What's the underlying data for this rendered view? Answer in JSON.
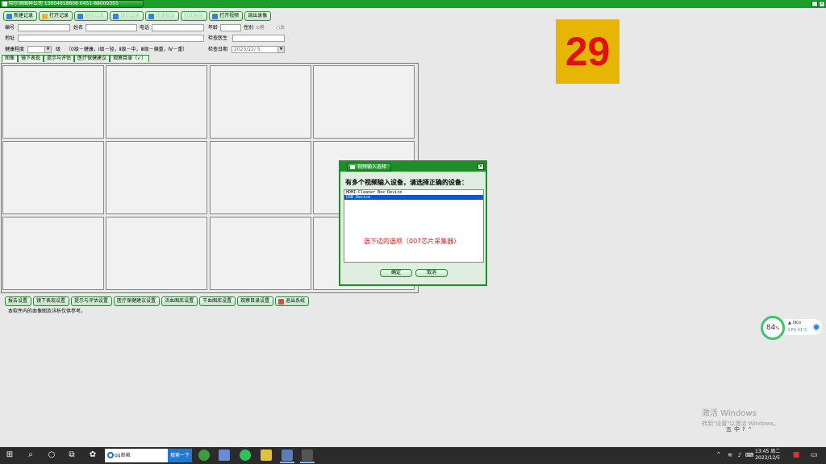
{
  "window": {
    "title": "哈尔滨国祥公司  13904618606    0451-88009355"
  },
  "toolbar": [
    {
      "label": "新建记录",
      "enabled": true
    },
    {
      "label": "打开记录",
      "enabled": true
    },
    {
      "label": "删除记录",
      "enabled": false
    },
    {
      "label": "保存记录",
      "enabled": false
    },
    {
      "label": "快速报告",
      "enabled": false
    },
    {
      "label": "打印报告",
      "enabled": false
    },
    {
      "label": "打开视频",
      "enabled": true
    },
    {
      "label": "调出录像",
      "enabled": true
    }
  ],
  "form": {
    "id_label": "编号",
    "name_label": "姓名",
    "phone_label": "电话",
    "age_label": "年龄",
    "gender_label": "性别",
    "gender_male": "男",
    "gender_female": "女",
    "address_label": "地址",
    "doctor_label": "检查医生",
    "health_label": "健康程度",
    "level_unit": "级",
    "level_hint": "（0级－健康，Ⅰ级－轻，Ⅱ级－中，Ⅲ级－偏重，Ⅳ－重）",
    "date_label": "检查日期",
    "date_value": "2023/12/ 5"
  },
  "tabs": [
    "图像",
    "镜下表现",
    "提示与评估",
    "医疗保健建议",
    "观察目录（✓）"
  ],
  "bottom_buttons": [
    "报告设置",
    "镜下表现设置",
    "提示与评估设置",
    "医疗保健建议设置",
    "活血图库设置",
    "干血图库设置",
    "观察目录设置",
    "退出系统"
  ],
  "notice": "本软件内的血像图及详析仅供参考。",
  "overlay_number": "29",
  "dialog": {
    "title": "视频输入选择",
    "close": "×",
    "prompt": "有多个视频输入设备，请选择正确的设备：",
    "devices": [
      "HDMI-Cleaner Box Device",
      "USB Device"
    ],
    "selected_index": 1,
    "hint": "选下边的选项（007芯片采集器）",
    "ok_label": "确定",
    "cancel_label": "取消"
  },
  "monitor": {
    "percent": "84",
    "percent_unit": "%",
    "speed": "0K/s",
    "cpu": "CPU 41°C"
  },
  "watermark": {
    "line1": "激活 Windows",
    "line2": "转到\"设置\"以激活 Windows。"
  },
  "ime": [
    "五",
    "中",
    "?",
    "⌃"
  ],
  "taskbar": {
    "search_text": "qq邮箱",
    "search_button": "搜索一下",
    "time": "13:45 周二",
    "date": "2023/12/5"
  },
  "colors": {
    "accent_green": "#1f9d2a",
    "overlay_bg": "#e7b604",
    "overlay_text": "#e01010",
    "hint_red": "#d01818",
    "selection_blue": "#0a58d0"
  }
}
